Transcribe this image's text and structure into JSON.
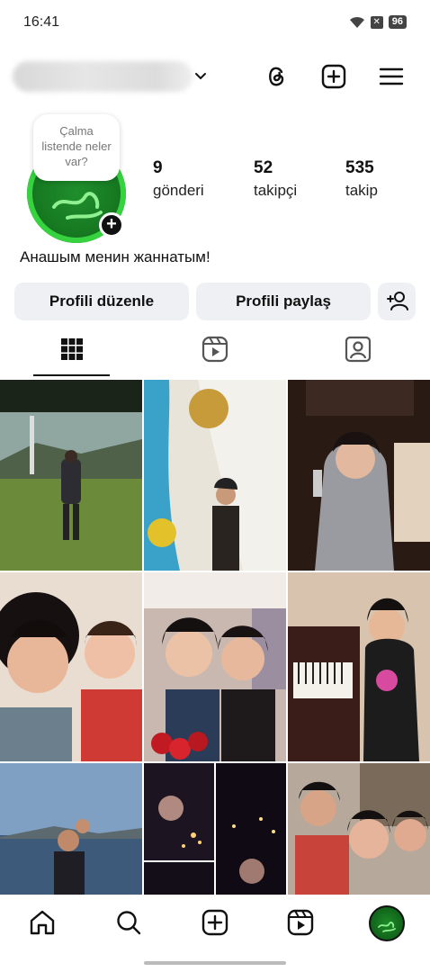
{
  "status_bar": {
    "time": "16:41",
    "battery": "96"
  },
  "note": {
    "text": "Çalma listende neler var?"
  },
  "stats": [
    {
      "value": "9",
      "label": "gönderi"
    },
    {
      "value": "52",
      "label": "takipçi"
    },
    {
      "value": "535",
      "label": "takip"
    }
  ],
  "bio": "Анашым менин жаннатым!",
  "buttons": {
    "edit_profile": "Profili düzenle",
    "share_profile": "Profili paylaş"
  },
  "icons": {
    "top_bar": [
      "threads-icon",
      "plus-square-icon",
      "menu-icon"
    ],
    "tabs": [
      "grid-icon",
      "reels-icon",
      "tagged-icon"
    ],
    "bottom_nav": [
      "home-icon",
      "search-icon",
      "create-icon",
      "reels-icon",
      "profile-avatar"
    ]
  },
  "colors": {
    "accent_green": "#36d23f",
    "button_bg": "#eef0f3"
  }
}
